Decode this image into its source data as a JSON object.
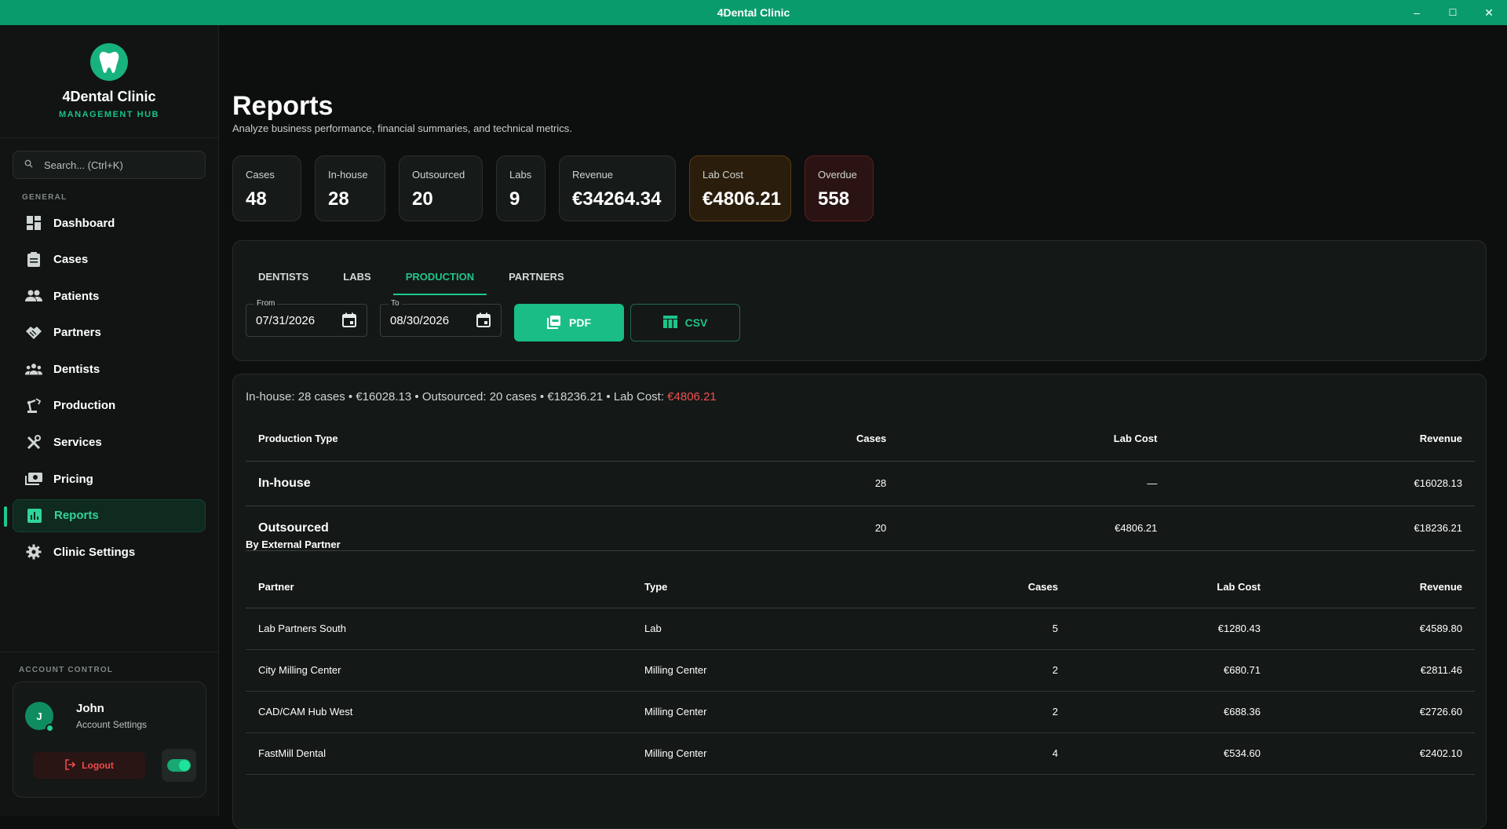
{
  "window": {
    "title": "4Dental Clinic",
    "minimize": "–",
    "maximize": "☐",
    "close": "✕"
  },
  "brand": {
    "name": "4Dental Clinic",
    "subtitle": "MANAGEMENT HUB"
  },
  "search": {
    "placeholder": "Search... (Ctrl+K)"
  },
  "sidebar": {
    "section_label": "GENERAL",
    "items": [
      {
        "label": "Dashboard",
        "icon": "dashboard-icon"
      },
      {
        "label": "Cases",
        "icon": "clipboard-icon"
      },
      {
        "label": "Patients",
        "icon": "people-icon"
      },
      {
        "label": "Partners",
        "icon": "handshake-icon"
      },
      {
        "label": "Dentists",
        "icon": "group-icon"
      },
      {
        "label": "Production",
        "icon": "precision-manufacturing-icon"
      },
      {
        "label": "Services",
        "icon": "tools-icon"
      },
      {
        "label": "Pricing",
        "icon": "payments-icon"
      },
      {
        "label": "Reports",
        "icon": "bar-chart-icon",
        "active": true
      },
      {
        "label": "Clinic Settings",
        "icon": "gear-icon"
      }
    ]
  },
  "account": {
    "section_label": "ACCOUNT CONTROL",
    "initial": "J",
    "name": "John",
    "subtitle": "Account Settings",
    "logout_label": "Logout"
  },
  "page": {
    "title": "Reports",
    "subtitle": "Analyze business performance, financial summaries, and technical metrics."
  },
  "stats": [
    {
      "label": "Cases",
      "value": "48"
    },
    {
      "label": "In-house",
      "value": "28"
    },
    {
      "label": "Outsourced",
      "value": "20"
    },
    {
      "label": "Labs",
      "value": "9"
    },
    {
      "label": "Revenue",
      "value": "€34264.34"
    },
    {
      "label": "Lab Cost",
      "value": "€4806.21",
      "tone": "warning"
    },
    {
      "label": "Overdue",
      "value": "558",
      "tone": "danger"
    }
  ],
  "tabs": [
    "DENTISTS",
    "LABS",
    "PRODUCTION",
    "PARTNERS"
  ],
  "active_tab": "PRODUCTION",
  "filters": {
    "from_label": "From",
    "from_value": "07/31/2026",
    "to_label": "To",
    "to_value": "08/30/2026",
    "pdf_label": "PDF",
    "csv_label": "CSV"
  },
  "summary": {
    "text": "In-house: 28 cases • €16028.13 • Outsourced: 20 cases • €18236.21 • Lab Cost: ",
    "lab_cost": "€4806.21"
  },
  "production_table": {
    "headers": [
      "Production Type",
      "Cases",
      "Lab Cost",
      "Revenue"
    ],
    "rows": [
      {
        "type": "In-house",
        "cases": "28",
        "lab_cost": "—",
        "revenue": "€16028.13"
      },
      {
        "type": "Outsourced",
        "cases": "20",
        "lab_cost": "€4806.21",
        "revenue": "€18236.21"
      }
    ]
  },
  "partner_section_title": "By External Partner",
  "partner_table": {
    "headers": [
      "Partner",
      "Type",
      "Cases",
      "Lab Cost",
      "Revenue"
    ],
    "rows": [
      {
        "partner": "Lab Partners South",
        "type": "Lab",
        "cases": "5",
        "lab_cost": "€1280.43",
        "revenue": "€4589.80"
      },
      {
        "partner": "City Milling Center",
        "type": "Milling Center",
        "cases": "2",
        "lab_cost": "€680.71",
        "revenue": "€2811.46"
      },
      {
        "partner": "CAD/CAM Hub West",
        "type": "Milling Center",
        "cases": "2",
        "lab_cost": "€688.36",
        "revenue": "€2726.60"
      },
      {
        "partner": "FastMill Dental",
        "type": "Milling Center",
        "cases": "4",
        "lab_cost": "€534.60",
        "revenue": "€2402.10"
      }
    ]
  },
  "colors": {
    "accent": "#1abd86",
    "titlebar": "#0a9b6c",
    "danger": "#f05050",
    "warning_bg": "#2a1d0c",
    "danger_bg": "#2b1313"
  }
}
